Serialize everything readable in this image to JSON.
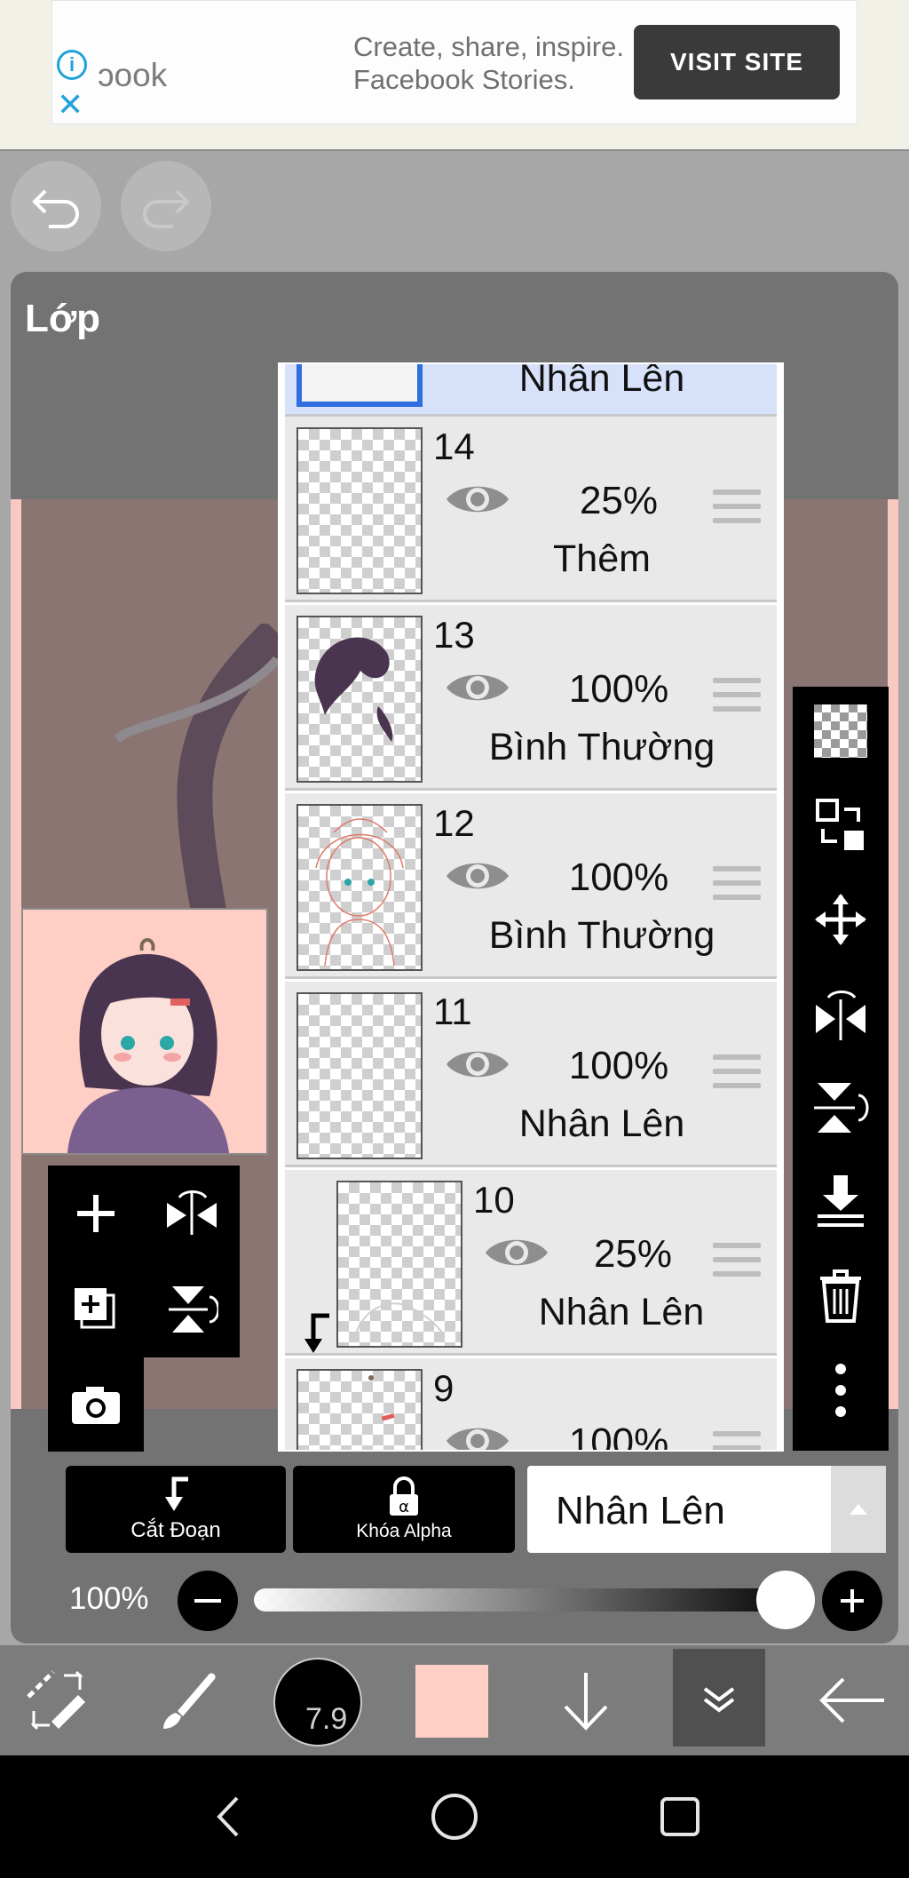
{
  "ad": {
    "brand_partial": "ɔook",
    "line1": "Create, share, inspire.",
    "line2": "Facebook Stories.",
    "button_label": "VISIT SITE"
  },
  "panel": {
    "title": "Lớp"
  },
  "layers": [
    {
      "blend": "Nhân Lên",
      "selected": true
    },
    {
      "number": "14",
      "opacity": "25%",
      "blend": "Thêm"
    },
    {
      "number": "13",
      "opacity": "100%",
      "blend": "Bình Thường"
    },
    {
      "number": "12",
      "opacity": "100%",
      "blend": "Bình Thường"
    },
    {
      "number": "11",
      "opacity": "100%",
      "blend": "Nhân Lên"
    },
    {
      "number": "10",
      "opacity": "25%",
      "blend": "Nhân Lên",
      "clipped": true
    },
    {
      "number": "9",
      "opacity": "100%"
    }
  ],
  "options": {
    "clip_label": "Cắt Đoạn",
    "alpha_lock_label": "Khóa Alpha",
    "blend_mode": "Nhân Lên"
  },
  "opacity": {
    "label": "100%",
    "value": 1.0
  },
  "toolbar": {
    "brush_size": "7.9",
    "color": "#ffcfc6"
  },
  "icons": {
    "left_tools": [
      "plus-icon",
      "flip-horizontal-icon",
      "add-layer-icon",
      "flip-vertical-icon",
      "camera-icon"
    ],
    "right_tools": [
      "transparency-icon",
      "layer-transfer-icon",
      "move-icon",
      "flip-h-icon",
      "flip-v-icon",
      "merge-down-icon",
      "trash-icon",
      "more-icon"
    ]
  }
}
